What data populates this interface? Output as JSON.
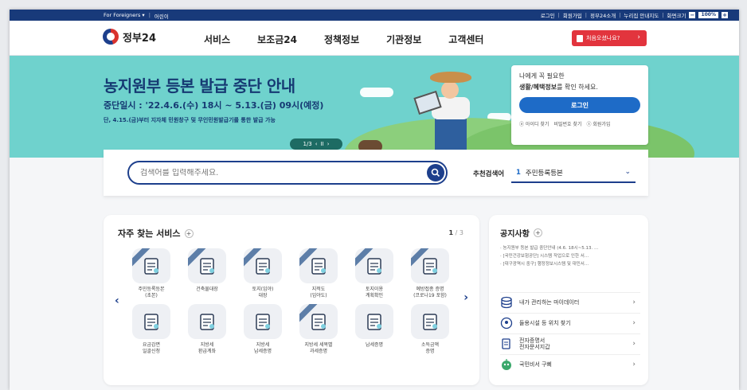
{
  "utilbar": {
    "foreigners": "For Foreigners ▾",
    "kids": "어린이",
    "links": [
      "로그인",
      "회원가입",
      "정부24소개",
      "누리집 안내지도"
    ],
    "zoom_label": "화면크기",
    "zoom_minus": "−",
    "zoom_value": "100%",
    "zoom_plus": "+"
  },
  "header": {
    "logo": "정부24",
    "nav": [
      "서비스",
      "보조금24",
      "정책정보",
      "기관정보",
      "고객센터"
    ],
    "first_visit": "처음오셨나요?",
    "first_visit_chev": "›"
  },
  "banner": {
    "title": "농지원부 등본 발급 중단 안내",
    "subtitle": "중단일시 : '22.4.6.(수) 18시 ~ 5.13.(금) 09시(예정)",
    "note": "단, 4.15.(금)부터 지자체 민원창구 및 무인민원발급기를 통한 발급 가능",
    "pager": "1/3",
    "pager_prev": "‹",
    "pager_pause": "II",
    "pager_next": "›"
  },
  "login": {
    "line1": "나에게 꼭 필요한",
    "line2_bold": "생활/혜택정보",
    "line2_rest": "를 확인 하세요.",
    "button": "로그인",
    "links": [
      "아이디 찾기",
      "비밀번호 찾기",
      "회원가입"
    ]
  },
  "search": {
    "placeholder": "검색어를 입력해주세요.",
    "rec_label": "추천검색어",
    "rec_num": "1",
    "rec_value": "주민등록등본",
    "rec_chev": "⌄"
  },
  "services": {
    "title": "자주 찾는 서비스",
    "plus": "+",
    "page_current": "1",
    "page_total": "/ 3",
    "prev": "‹",
    "next": "›",
    "items": [
      {
        "label": "주민등록등본\n(초본)",
        "icon": "id-card-icon"
      },
      {
        "label": "건축물대장",
        "icon": "document-search-icon"
      },
      {
        "label": "토지(임야)\n대장",
        "icon": "map-pin-icon"
      },
      {
        "label": "지적도\n(임야도)",
        "icon": "map-icon"
      },
      {
        "label": "토지이용\n계획확인",
        "icon": "map-pin-route-icon"
      },
      {
        "label": "예방접종 증명\n(코로나19 포함)",
        "icon": "vaccine-doc-icon"
      },
      {
        "label": "요금감면\n일괄신청",
        "icon": "coin-stack-icon"
      },
      {
        "label": "지방세\n환급계좌",
        "icon": "laptop-money-icon"
      },
      {
        "label": "지방세\n납세증명",
        "icon": "tax-doc-icon"
      },
      {
        "label": "지방세 세목별\n과세증명",
        "icon": "chart-search-icon"
      },
      {
        "label": "납세증명",
        "icon": "tax-stack-icon"
      },
      {
        "label": "소득금액\n증명",
        "icon": "income-doc-icon"
      }
    ]
  },
  "notice": {
    "title": "공지사항",
    "plus": "+",
    "items": [
      "· 농지원부 등본 발급 중단안내 (4.6. 18시~5.13. ...",
      "· [국민건강보험공단] 시스템 작업으로 인한 서...",
      "· [대구광역시 중구] 행정정보시스템 및 대민서..."
    ],
    "quick": [
      {
        "label": "내가 관리하는 마이데이터",
        "icon": "database-icon"
      },
      {
        "label": "들용시설 등 위치 찾기",
        "icon": "location-pin-icon"
      },
      {
        "label": "전자증명서\n전자문서지갑",
        "icon": "wallet-doc-icon"
      },
      {
        "label": "국민비서 구삐",
        "icon": "bot-mascot-icon"
      }
    ],
    "chev": "›"
  },
  "colors": {
    "navy": "#183a7a",
    "banner": "#6fd2cd",
    "accent_red": "#e2343d",
    "accent_blue": "#1e6bc7"
  }
}
